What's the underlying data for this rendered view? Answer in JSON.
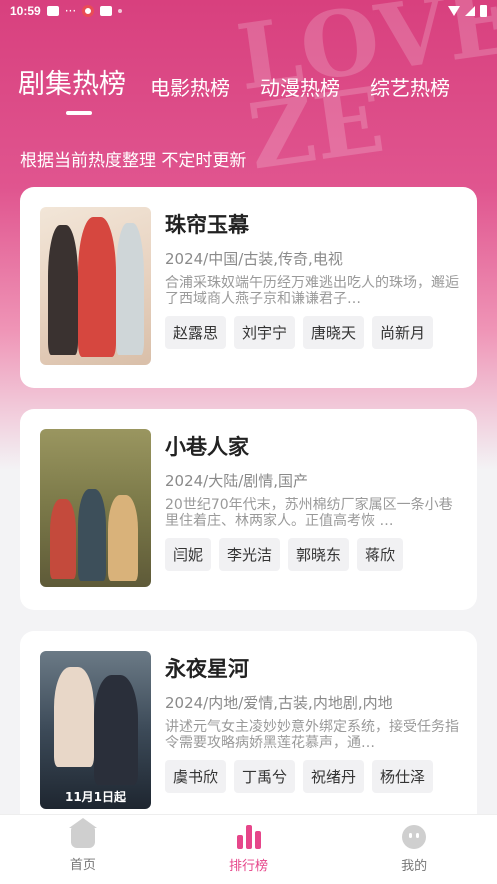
{
  "status_bar": {
    "time": "10:59",
    "dots": "···"
  },
  "header": {
    "tabs": [
      {
        "label": "剧集热榜",
        "active": true
      },
      {
        "label": "电影热榜",
        "active": false
      },
      {
        "label": "动漫热榜",
        "active": false
      },
      {
        "label": "综艺热榜",
        "active": false
      }
    ],
    "subtitle": "根据当前热度整理 不定时更新"
  },
  "shows": [
    {
      "title": "珠帘玉幕",
      "meta": "2024/中国/古装,传奇,电视",
      "desc": "合浦采珠奴端午历经万难逃出吃人的珠场，邂逅了西域商人燕子京和谦谦君子…",
      "actors": [
        "赵露思",
        "刘宇宁",
        "唐晓天",
        "尚新月"
      ],
      "poster_color": "#e9d9c9",
      "poster_accent": "#c8393d"
    },
    {
      "title": "小巷人家",
      "meta": "2024/大陆/剧情,国产",
      "desc": "20世纪70年代末，苏州棉纺厂家属区一条小巷里住着庄、林两家人。正值高考恢 …",
      "actors": [
        "闫妮",
        "李光洁",
        "郭晓东",
        "蒋欣"
      ],
      "poster_color": "#8b8a55",
      "poster_accent": "#c9a35b"
    },
    {
      "title": "永夜星河",
      "meta": "2024/内地/爱情,古装,内地剧,内地",
      "desc": "讲述元气女主凌妙妙意外绑定系统，接受任务指令需要攻略病娇黑莲花慕声，通…",
      "actors": [
        "虞书欣",
        "丁禹兮",
        "祝绪丹",
        "杨仕泽"
      ],
      "poster_color": "#2c3a4a",
      "poster_accent": "#d7c6b7",
      "poster_date": "11月1日起"
    }
  ],
  "bottom_nav": [
    {
      "label": "首页",
      "icon": "home-icon",
      "active": false
    },
    {
      "label": "排行榜",
      "icon": "rank-icon",
      "active": true
    },
    {
      "label": "我的",
      "icon": "profile-icon",
      "active": false
    }
  ],
  "colors": {
    "brand": "#e6468a",
    "hero": "#d8407e"
  }
}
